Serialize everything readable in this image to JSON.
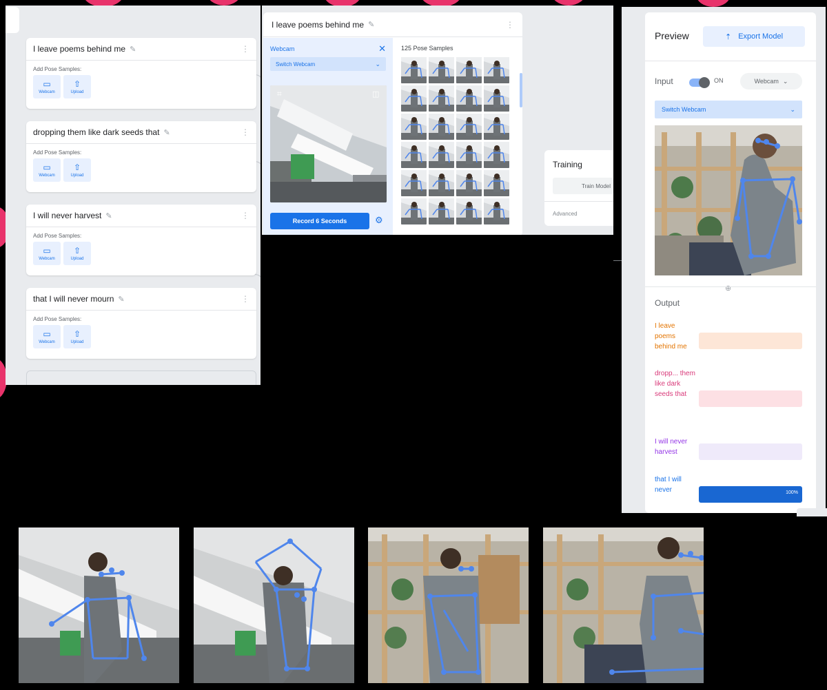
{
  "classes": [
    {
      "name": "I leave poems behind me",
      "add_label": "Add Pose Samples:",
      "webcam_label": "Webcam",
      "upload_label": "Upload"
    },
    {
      "name": "dropping them like dark seeds that",
      "add_label": "Add Pose Samples:",
      "webcam_label": "Webcam",
      "upload_label": "Upload"
    },
    {
      "name": "I will never harvest",
      "add_label": "Add Pose Samples:",
      "webcam_label": "Webcam",
      "upload_label": "Upload"
    },
    {
      "name": "that I will never mourn",
      "add_label": "Add Pose Samples:",
      "webcam_label": "Webcam",
      "upload_label": "Upload"
    }
  ],
  "recording": {
    "class_name": "I leave poems behind me",
    "source_title": "Webcam",
    "switch_label": "Switch Webcam",
    "record_label": "Record 6 Seconds",
    "samples_label": "125 Pose Samples"
  },
  "training": {
    "title": "Training",
    "train_label": "Train Model",
    "advanced_label": "Advanced"
  },
  "preview": {
    "title": "Preview",
    "export_label": "Export Model",
    "input_label": "Input",
    "toggle_state": "ON",
    "source_label": "Webcam",
    "switch_label": "Switch Webcam",
    "output_title": "Output",
    "outputs": [
      {
        "label": "I leave poems behind me",
        "confidence": 0,
        "color": "#e37400",
        "bar_bg": "#fde6d7"
      },
      {
        "label": "dropp... them like dark seeds that",
        "color": "#d93a7a",
        "confidence": 0,
        "bar_bg": "#fde0e4"
      },
      {
        "label": "I will never harvest",
        "color": "#9334e6",
        "confidence": 0,
        "bar_bg": "#efeafa"
      },
      {
        "label": "that I will never",
        "color": "#1a73e8",
        "confidence": 1.0,
        "bar_bg": "#1967d2",
        "pct_text": "100%"
      }
    ]
  },
  "icons": {
    "pencil": "pencil-icon",
    "kebab": "more-vert-icon",
    "webcam": "videocam-icon",
    "upload": "upload-icon",
    "close": "close-icon",
    "chevron": "chevron-down-icon",
    "settings": "settings-icon",
    "export": "export-icon",
    "arrow_down": "arrow-down-icon"
  },
  "colors": {
    "accent": "#1a73e8",
    "panel_bg": "#e9ebee",
    "pose": "#4f86ec"
  }
}
